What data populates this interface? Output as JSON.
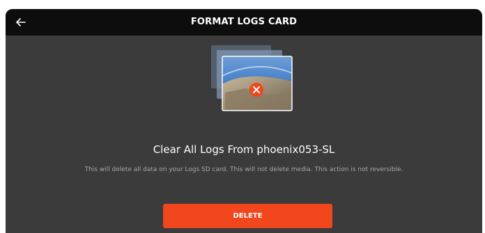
{
  "header": {
    "title": "FORMAT LOGS CARD",
    "back_icon": "arrow-left-icon"
  },
  "illustration": {
    "icon": "delete-x-icon",
    "accent_color": "#f2461c"
  },
  "main": {
    "heading": "Clear All Logs From phoenix053-SL",
    "description": "This will delete all data on your Logs SD card. This will not delete media. This action is not reversible.",
    "delete_label": "DELETE"
  },
  "colors": {
    "background": "#3b3b3b",
    "header": "#0d0d0d",
    "accent": "#f2461c",
    "text_primary": "#ffffff",
    "text_secondary": "#a8a8a8"
  }
}
